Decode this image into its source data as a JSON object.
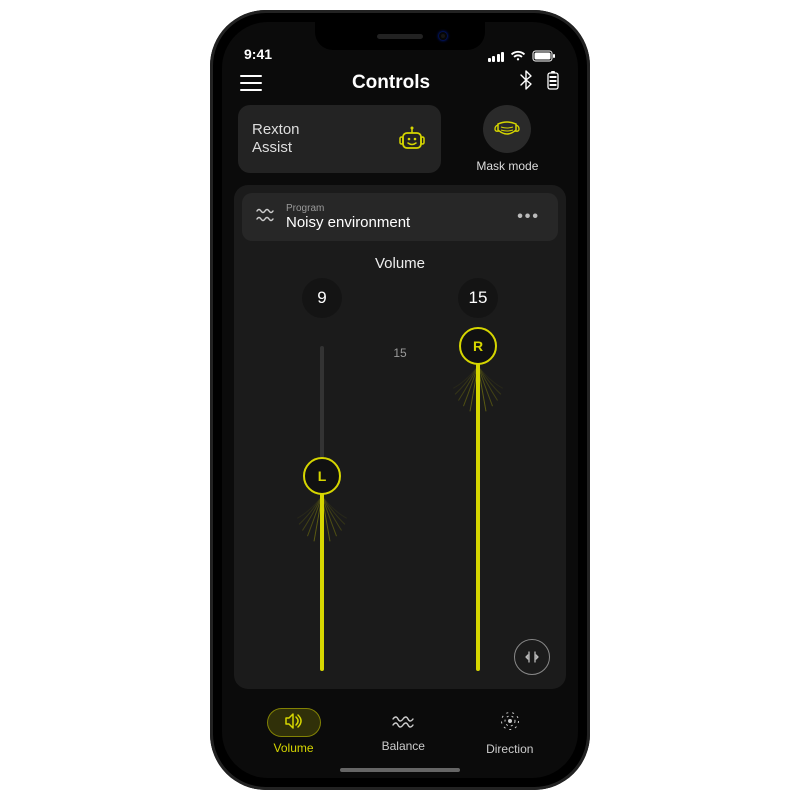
{
  "status": {
    "time": "9:41"
  },
  "header": {
    "title": "Controls"
  },
  "quick": {
    "assist": {
      "line1": "Rexton",
      "line2": "Assist"
    },
    "mask": {
      "label": "Mask mode"
    }
  },
  "program": {
    "caption": "Program",
    "name": "Noisy environment"
  },
  "volume": {
    "heading": "Volume",
    "scale": {
      "min": "0",
      "max": "15"
    },
    "left": {
      "value": "9",
      "thumb": "L",
      "level": 9,
      "max": 15
    },
    "right": {
      "value": "15",
      "thumb": "R",
      "level": 15,
      "max": 15
    }
  },
  "tabs": [
    {
      "label": "Volume",
      "active": true
    },
    {
      "label": "Balance",
      "active": false
    },
    {
      "label": "Direction",
      "active": false
    }
  ],
  "colors": {
    "accent": "#d6d600"
  }
}
